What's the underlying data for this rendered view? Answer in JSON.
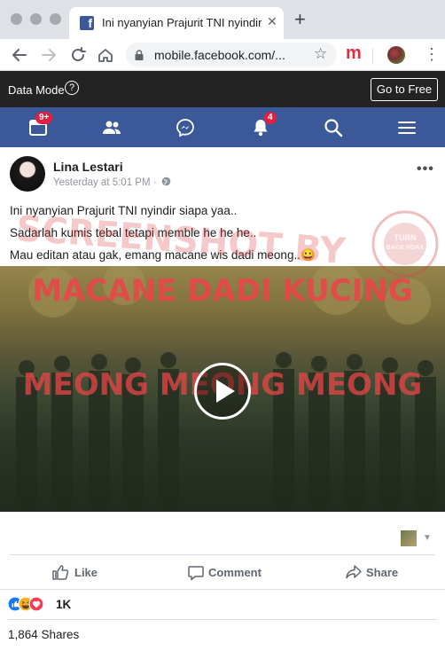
{
  "browser": {
    "tab_title": "Ini nyanyian Prajurit TNI nyindir",
    "url": "mobile.facebook.com/...",
    "new_tab_label": "+",
    "close_tab_label": "✕"
  },
  "fb_header": {
    "data_mode_label": "Data Mode",
    "go_to_free_label": "Go to Free",
    "feed_badge": "9+",
    "notifications_badge": "4"
  },
  "post": {
    "author": "Lina Lestari",
    "timestamp": "Yesterday at 5:01 PM ·",
    "text_lines": [
      "Ini nyanyian Prajurit TNI nyindir siapa yaa..",
      "Sadarlah kumis tebal tetapi memble he he he..",
      "Mau editan atau gak, emang macane wis dadi meong..😀"
    ],
    "watermark": "SCREENSHOT BY",
    "stamp_text": "TURN BACK HOAX",
    "video": {
      "caption_top": "MACANE DADI KUCING",
      "caption_mid": "MEONG MEONG MEONG"
    },
    "actions": {
      "like": "Like",
      "comment": "Comment",
      "share": "Share"
    },
    "reactions_count": "1K",
    "shares": "1,864 Shares"
  },
  "colors": {
    "facebook_blue": "#3b5998",
    "badge_red": "#e41e3f",
    "data_mode_bar": "#232323"
  }
}
